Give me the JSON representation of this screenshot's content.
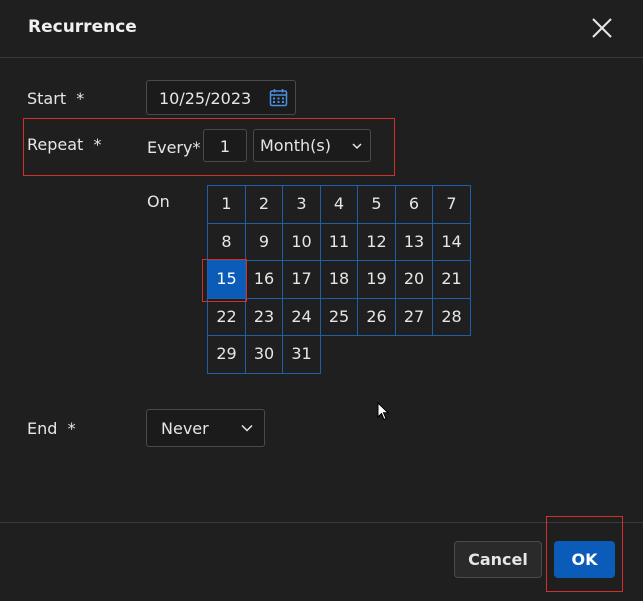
{
  "dialog": {
    "title": "Recurrence",
    "close_icon": "close-icon"
  },
  "start": {
    "label": "Start",
    "required_marker": "*",
    "value": "10/25/2023",
    "icon": "calendar-icon"
  },
  "repeat": {
    "label": "Repeat",
    "required_marker": "*",
    "every_label": "Every*",
    "every_value": "1",
    "unit_value": "Month(s)",
    "unit_icon": "chevron-down-icon"
  },
  "on": {
    "label": "On",
    "days": [
      "1",
      "2",
      "3",
      "4",
      "5",
      "6",
      "7",
      "8",
      "9",
      "10",
      "11",
      "12",
      "13",
      "14",
      "15",
      "16",
      "17",
      "18",
      "19",
      "20",
      "21",
      "22",
      "23",
      "24",
      "25",
      "26",
      "27",
      "28",
      "29",
      "30",
      "31"
    ],
    "selected_day": "15"
  },
  "end": {
    "label": "End",
    "required_marker": "*",
    "value": "Never",
    "icon": "chevron-down-icon"
  },
  "footer": {
    "cancel_label": "Cancel",
    "ok_label": "OK"
  },
  "colors": {
    "background": "#1f1f1f",
    "accent": "#0b5cb8",
    "day_border": "#1f5fa8",
    "highlight": "#d32f2f"
  }
}
